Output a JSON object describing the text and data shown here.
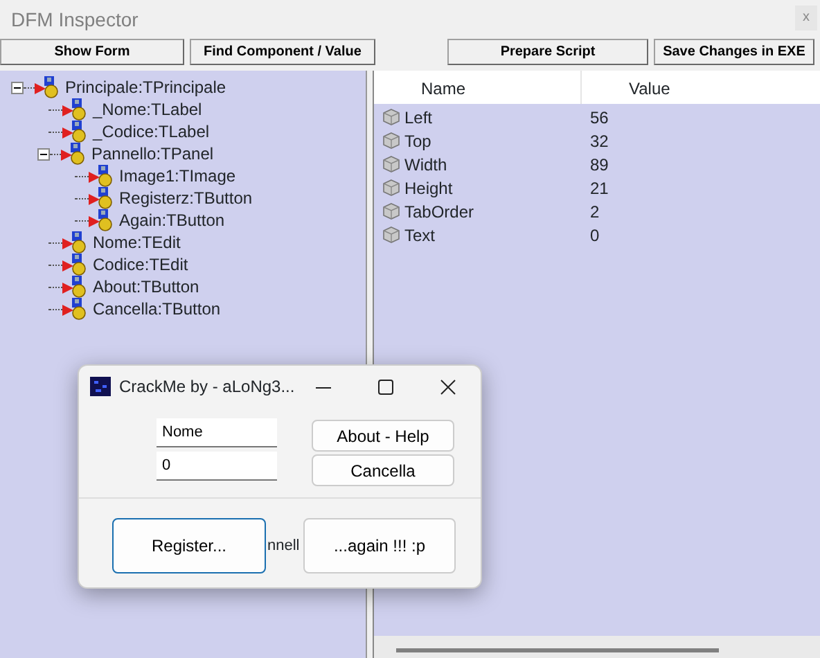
{
  "window": {
    "title": "DFM Inspector",
    "close": "x"
  },
  "toolbar": {
    "left": [
      "Show Form",
      "Find Component / Value"
    ],
    "right": [
      "Prepare Script",
      "Save Changes in EXE"
    ]
  },
  "tree": [
    {
      "label": "Principale:TPrincipale",
      "expanded": true,
      "children": [
        {
          "label": "_Nome:TLabel"
        },
        {
          "label": "_Codice:TLabel"
        },
        {
          "label": "Pannello:TPanel",
          "expanded": true,
          "children": [
            {
              "label": "Image1:TImage"
            },
            {
              "label": "Registerz:TButton"
            },
            {
              "label": "Again:TButton"
            }
          ]
        },
        {
          "label": "Nome:TEdit"
        },
        {
          "label": "Codice:TEdit"
        },
        {
          "label": "About:TButton"
        },
        {
          "label": "Cancella:TButton"
        }
      ]
    }
  ],
  "properties": {
    "columns": [
      "Name",
      "Value"
    ],
    "rows": [
      {
        "name": "Left",
        "value": "56"
      },
      {
        "name": "Top",
        "value": "32"
      },
      {
        "name": "Width",
        "value": "89"
      },
      {
        "name": "Height",
        "value": "21"
      },
      {
        "name": "TabOrder",
        "value": "2"
      },
      {
        "name": "Text",
        "value": "0"
      }
    ]
  },
  "form": {
    "title": "CrackMe by - aLoNg3...",
    "name_value": "Nome",
    "code_value": "0",
    "about_button": "About - Help",
    "cancel_button": "Cancella",
    "register_button": "Register...",
    "panel_caption": "nnell",
    "again_button": "...again !!! :p"
  }
}
